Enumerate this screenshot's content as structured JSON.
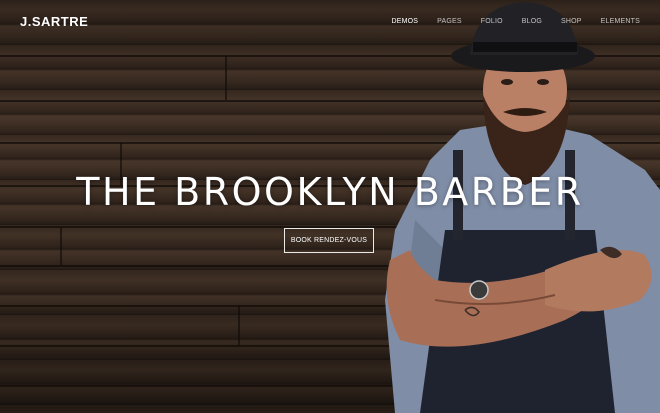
{
  "brand": {
    "logo_text": "J.SARTRE"
  },
  "nav": {
    "items": [
      {
        "label": "DEMOS",
        "active": true
      },
      {
        "label": "PAGES",
        "active": false
      },
      {
        "label": "FOLIO",
        "active": false
      },
      {
        "label": "BLOG",
        "active": false
      },
      {
        "label": "SHOP",
        "active": false
      },
      {
        "label": "ELEMENTS",
        "active": false
      }
    ]
  },
  "hero": {
    "headline": "THE BROOKLYN BARBER",
    "cta_label": "BOOK RENDEZ-VOUS"
  },
  "colors": {
    "text": "#ffffff",
    "wood_dark": "#2a1f18",
    "wood_mid": "#4a382b"
  }
}
